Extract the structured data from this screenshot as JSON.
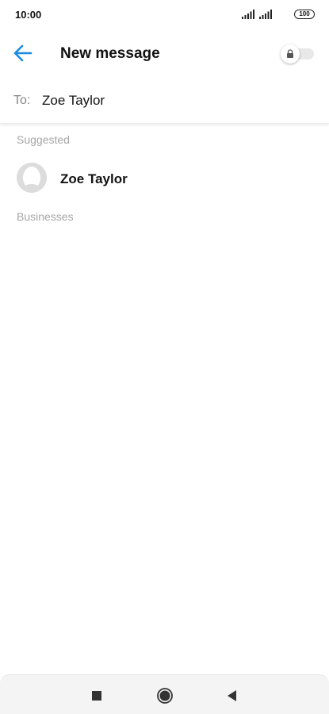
{
  "status_bar": {
    "time": "10:00",
    "battery": "100"
  },
  "header": {
    "title": "New message",
    "back_icon": "arrow-left-icon",
    "lock_toggle_icon": "lock-icon",
    "accent_color": "#1a8be0"
  },
  "recipient": {
    "label": "To:",
    "value": "Zoe Taylor"
  },
  "sections": {
    "suggested": "Suggested",
    "businesses": "Businesses"
  },
  "contacts": [
    {
      "name": "Zoe Taylor",
      "avatar_icon": "person-placeholder-icon"
    }
  ],
  "nav": {
    "recents_icon": "square-icon",
    "home_icon": "circle-icon",
    "back_icon": "triangle-back-icon"
  }
}
